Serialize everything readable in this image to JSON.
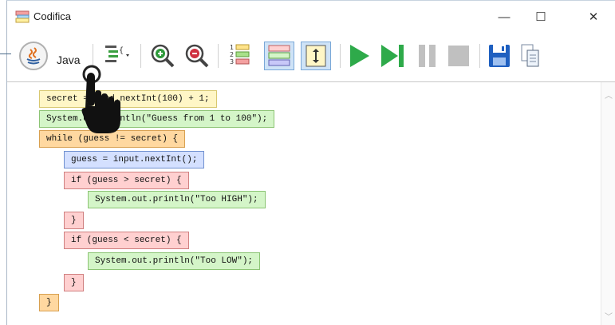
{
  "window": {
    "title": "Codifica",
    "controls": {
      "minimize": "—",
      "maximize": "☐",
      "close": "✕"
    }
  },
  "toolbar": {
    "language_label": "Java",
    "icons": [
      "java-language-icon",
      "code-format-icon",
      "zoom-in-icon",
      "zoom-out-icon",
      "line-numbers-icon",
      "blocks-view-icon",
      "fit-view-icon",
      "run-icon",
      "step-icon",
      "pause-icon",
      "stop-icon",
      "save-icon",
      "copy-icon"
    ],
    "colors": {
      "green": "#2eaa4a",
      "gray": "#c0c0c0",
      "blue": "#1e5fc0",
      "highlight": "#cfe3f7"
    }
  },
  "code_blocks": [
    {
      "text": "secret = rand.nextInt(100) + 1;",
      "color": "yellow"
    },
    {
      "text": "System.out.println(\"Guess from 1 to 100\");",
      "color": "green"
    },
    {
      "text": "while (guess != secret) {",
      "color": "orange"
    },
    {
      "text": "guess = input.nextInt();",
      "color": "blue"
    },
    {
      "text": "if (guess > secret) {",
      "color": "red"
    },
    {
      "text": "System.out.println(\"Too HIGH\");",
      "color": "green"
    },
    {
      "text": "}",
      "color": "red"
    },
    {
      "text": "if (guess < secret) {",
      "color": "red"
    },
    {
      "text": "System.out.println(\"Too LOW\");",
      "color": "green"
    },
    {
      "text": "}",
      "color": "red"
    },
    {
      "text": "}",
      "color": "orange"
    }
  ]
}
